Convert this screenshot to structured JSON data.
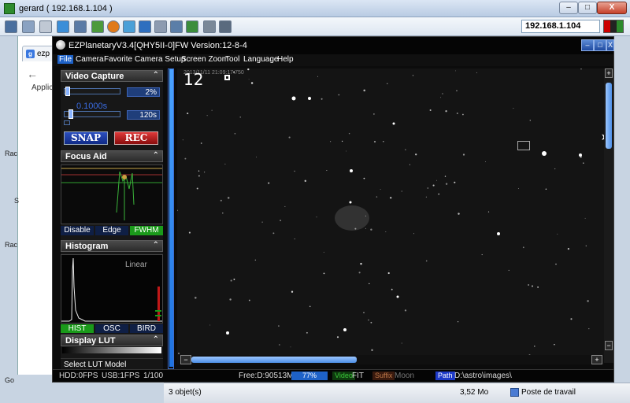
{
  "viewer": {
    "title": "gerard ( 192.168.1.104 )",
    "address": "192.168.1.104",
    "min_label": "–",
    "max_label": "□",
    "close_label": "X"
  },
  "background_browser": {
    "tab_label": "ezp",
    "apps_label": "Applic",
    "left_texts": [
      "Rac",
      "S",
      "Rac",
      "Go"
    ]
  },
  "explorer_status": {
    "objects": "3 objet(s)",
    "size": "3,52 Mo",
    "location": "Poste de travail"
  },
  "app": {
    "title": "EZPlanetaryV3.4[QHY5II-0]FW Version:12-8-4",
    "menu": [
      "File",
      "Camera",
      "Favorite",
      "Camera Setup",
      "Screen Zoom",
      "Tool",
      "Language",
      "Help"
    ],
    "winbtns": [
      "–",
      "□",
      "X"
    ]
  },
  "video_capture": {
    "title": "Video Capture",
    "gain_value": "2%",
    "gain_overlay": "0.1000s",
    "exposure_value": "120s",
    "gain_fraction": 0.02,
    "exposure_fraction": 0.08,
    "snap_label": "SNAP",
    "rec_label": "REC"
  },
  "focus_aid": {
    "title": "Focus Aid",
    "tabs": [
      "Disable",
      "Edge",
      "FWHM"
    ]
  },
  "histogram": {
    "title": "Histogram",
    "mode": "Linear",
    "tabs": [
      "HIST",
      "OSC",
      "BIRD"
    ]
  },
  "display_lut": {
    "title": "Display LUT",
    "select_label": "Select LUT Model"
  },
  "image": {
    "frame_count": "12",
    "timestamp": "2013/11/11 21:09:17:750"
  },
  "status": {
    "hdd": "HDD:0FPS",
    "usb": "USB:1FPS",
    "frames": "1/100",
    "free": "Free:D:90513MB",
    "free_percent": "77%",
    "video_label": "Video",
    "video_value": "FIT",
    "suffix_label": "Suffix",
    "suffix_value": "Moon",
    "path_label": "Path",
    "path_value": "D:\\astro\\images\\"
  },
  "colors": {
    "accent_blue": "#1e62c8",
    "rec_red": "#c01818",
    "fwhm_green": "#1a9a1a"
  }
}
